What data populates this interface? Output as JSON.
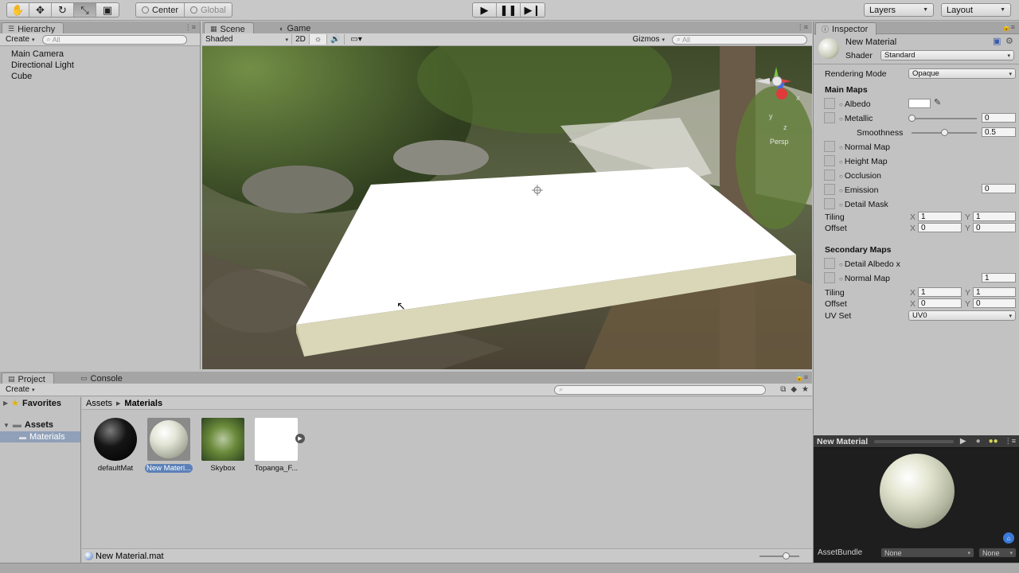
{
  "toolbar": {
    "transform_tools": [
      "hand-tool-icon",
      "move-tool-icon",
      "rotate-tool-icon",
      "scale-tool-icon",
      "rect-tool-icon"
    ],
    "pivot_label": "Center",
    "space_label": "Global",
    "layers_label": "Layers",
    "layout_label": "Layout"
  },
  "hierarchy": {
    "tab_label": "Hierarchy",
    "create_label": "Create",
    "search_placeholder": "All",
    "items": [
      "Main Camera",
      "Directional Light",
      "Cube"
    ]
  },
  "scene": {
    "tabs": [
      "Scene",
      "Game"
    ],
    "shading_mode": "Shaded",
    "mode_2d": "2D",
    "gizmos_label": "Gizmos",
    "search_placeholder": "All",
    "persp_label": "Persp",
    "gizmo_axes": [
      "y",
      "x",
      "z"
    ]
  },
  "inspector": {
    "tab_label": "Inspector",
    "material_name": "New Material",
    "shader_label": "Shader",
    "shader_value": "Standard",
    "rendering_mode_label": "Rendering Mode",
    "rendering_mode_value": "Opaque",
    "main_maps_title": "Main Maps",
    "albedo_label": "Albedo",
    "metallic_label": "Metallic",
    "metallic_value": "0",
    "metallic_fraction": 0.0,
    "smoothness_label": "Smoothness",
    "smoothness_value": "0.5",
    "smoothness_fraction": 0.5,
    "normal_map_label": "Normal Map",
    "height_map_label": "Height Map",
    "occlusion_label": "Occlusion",
    "emission_label": "Emission",
    "emission_value": "0",
    "detail_mask_label": "Detail Mask",
    "tiling_label": "Tiling",
    "offset_label": "Offset",
    "x_label": "X",
    "y_label": "Y",
    "main_tiling_x": "1",
    "main_tiling_y": "1",
    "main_offset_x": "0",
    "main_offset_y": "0",
    "secondary_maps_title": "Secondary Maps",
    "detail_albedo_label": "Detail Albedo x",
    "secondary_normal_label": "Normal Map",
    "secondary_normal_value": "1",
    "sec_tiling_x": "1",
    "sec_tiling_y": "1",
    "sec_offset_x": "0",
    "sec_offset_y": "0",
    "uv_set_label": "UV Set",
    "uv_set_value": "UV0"
  },
  "preview": {
    "title": "New Material",
    "assetbundle_label": "AssetBundle",
    "assetbundle_value": "None",
    "variant_value": "None"
  },
  "project": {
    "tabs": [
      "Project",
      "Console"
    ],
    "create_label": "Create",
    "favorites_label": "Favorites",
    "assets_label": "Assets",
    "materials_label": "Materials",
    "breadcrumb": [
      "Assets",
      "Materials"
    ],
    "assets": [
      {
        "label": "defaultMat"
      },
      {
        "label": "New Materi..."
      },
      {
        "label": "Skybox"
      },
      {
        "label": "Topanga_F..."
      }
    ],
    "selected_file": "New Material.mat"
  }
}
